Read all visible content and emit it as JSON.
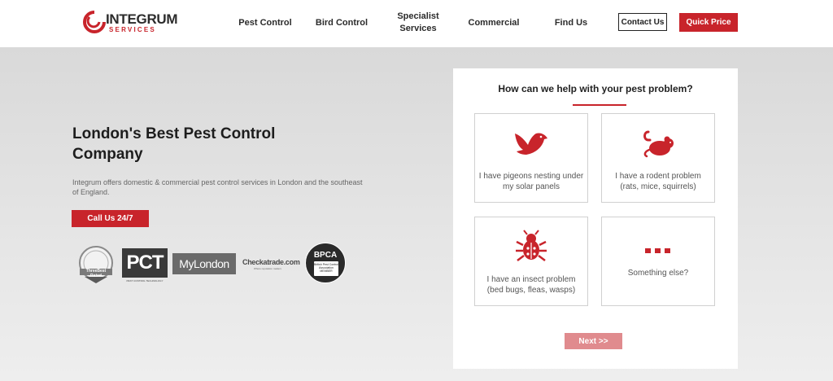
{
  "header": {
    "logo": {
      "main": "INTEGRUM",
      "sub": "SERVICES"
    },
    "nav": [
      {
        "label": "Pest Control"
      },
      {
        "label": "Bird Control"
      },
      {
        "label": "Specialist Services"
      },
      {
        "label": "Commercial"
      },
      {
        "label": "Find Us"
      }
    ],
    "contact_label": "Contact Us",
    "quick_price_label": "Quick Price"
  },
  "hero": {
    "title": "London's Best Pest Control Company",
    "description": "Integrum offers domestic & commercial pest control services in London and the southeast of England.",
    "call_label": "Call Us 24/7",
    "badges": {
      "threebest": "ThreeBest Rated",
      "pct": "PCT",
      "pct_sub": "PEST CONTROL TECHNOLOGY",
      "mylondon": "MyLondon",
      "checkatrade": "Checkatrade.com",
      "checkatrade_sub": "Where reputation matters",
      "bpca": "BPCA",
      "bpca_sub": "British Pest Control Association MEMBER"
    }
  },
  "panel": {
    "title": "How can we help with your pest problem?",
    "options": [
      {
        "label": "I have pigeons nesting under my solar panels",
        "icon": "bird-icon"
      },
      {
        "label": "I have a rodent problem (rats, mice, squirrels)",
        "icon": "rodent-icon"
      },
      {
        "label": "I have an insect problem (bed bugs, fleas, wasps)",
        "icon": "insect-icon"
      },
      {
        "label": "Something else?",
        "icon": "more-dots-icon"
      }
    ],
    "next_label": "Next >>"
  },
  "colors": {
    "brand_red": "#c8242b",
    "next_disabled": "#e08b8e",
    "text_dark": "#1d1d1d"
  }
}
